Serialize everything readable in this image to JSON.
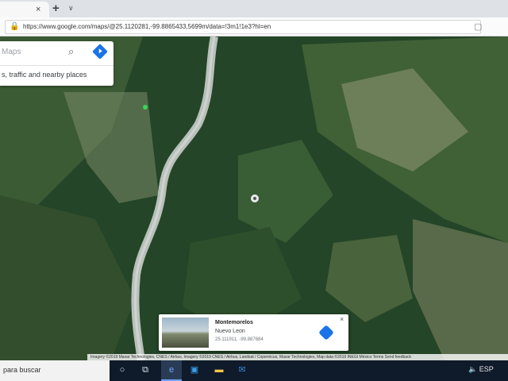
{
  "browser": {
    "tab_close": "×",
    "new_tab": "+",
    "tab_menu": "∨",
    "url_prefix": "https://",
    "url": "https://www.google.com/maps/@25.1120281,-99.8865433,5699m/data=!3m1!1e3?hl=en",
    "lock_icon": "lock-icon",
    "star_icon": "star-icon"
  },
  "map_search": {
    "placeholder": "Maps",
    "hint": "s, traffic and nearby places"
  },
  "place_card": {
    "title": "Montemorelos",
    "subtitle": "Nuevo Leon",
    "coordinates": "25.111911, -99.887684",
    "close": "×"
  },
  "attribution": "Imagery ©2019 Maxar Technologies, CNES / Airbus, Imagery ©2019 CNES / Airbus, Landsat / Copernicus, Maxar Technologies, Map data ©2019 INEGI    México    Terms    Send feedback",
  "taskbar": {
    "search_text": "para buscar",
    "tray_text": "🔈 ESP"
  },
  "colors": {
    "map_base": "#264a28",
    "river": "#b9c0bb",
    "accent": "#1a73e8",
    "taskbar": "#0f1a2a"
  }
}
